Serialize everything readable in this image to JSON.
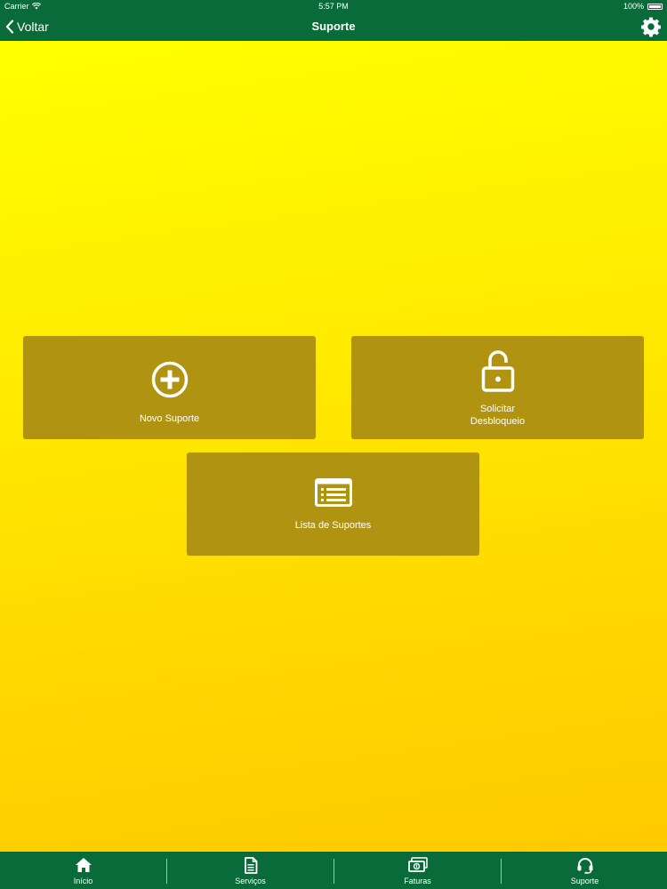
{
  "status_bar": {
    "carrier": "Carrier",
    "time": "5:57 PM",
    "battery": "100%"
  },
  "nav": {
    "back_label": "Voltar",
    "title": "Suporte",
    "settings_icon": "gear-icon"
  },
  "tiles": [
    {
      "label": "Novo Suporte",
      "icon": "plus-circle-icon"
    },
    {
      "label_line1": "Solicitar",
      "label_line2": "Desbloqueio",
      "icon": "unlock-icon"
    },
    {
      "label": "Lista de Suportes",
      "icon": "list-icon"
    }
  ],
  "tabs": [
    {
      "label": "Início",
      "icon": "home-icon"
    },
    {
      "label": "Serviços",
      "icon": "document-icon"
    },
    {
      "label": "Faturas",
      "icon": "money-icon"
    },
    {
      "label": "Suporte",
      "icon": "headset-icon"
    }
  ],
  "colors": {
    "brand_green": "#0a6b3a",
    "tile_background": "#b19312",
    "background_top": "#ffff00",
    "background_bottom": "#ffca00"
  }
}
